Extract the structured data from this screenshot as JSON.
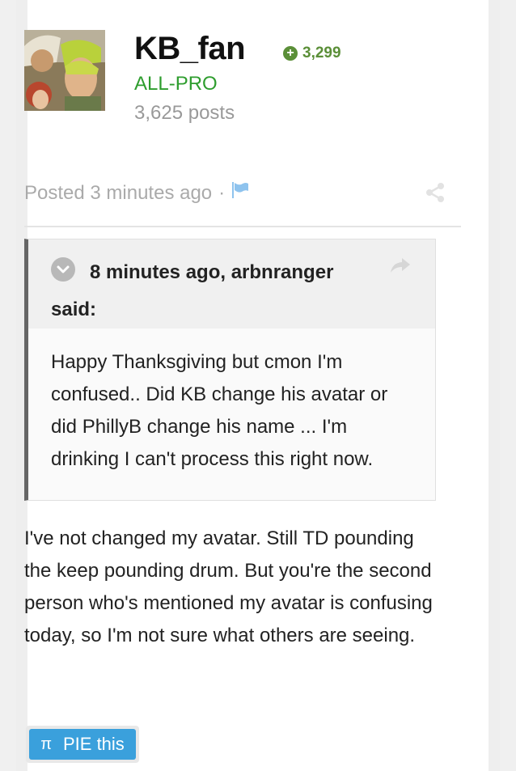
{
  "author": {
    "username": "KB_fan",
    "reputation": "3,299",
    "rank": "ALL-PRO",
    "post_count": "3,625 posts"
  },
  "post": {
    "posted_time": "Posted 3 minutes ago",
    "separator": "·",
    "quote": {
      "citation": "8 minutes ago, arbnranger said:",
      "text": "Happy Thanksgiving but cmon I'm confused.. Did KB change his avatar or did PhillyB change his name ... I'm drinking I can't process this right now."
    },
    "body": "I've not changed my avatar.  Still TD pounding the keep pounding drum.  But you're the second person who's mentioned my avatar is confusing today, so I'm not sure what others are seeing."
  },
  "actions": {
    "pie_icon": "π",
    "pie_label": "PIE this"
  },
  "colors": {
    "reputation": "#5b8f38",
    "rank": "#2e9d2e",
    "pie_button": "#3aa0dc",
    "flag": "#8ec3ee"
  }
}
